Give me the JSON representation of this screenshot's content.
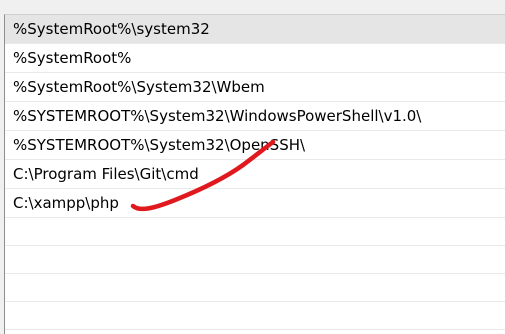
{
  "path_list": {
    "entries": [
      "%SystemRoot%\\system32",
      "%SystemRoot%",
      "%SystemRoot%\\System32\\Wbem",
      "%SYSTEMROOT%\\System32\\WindowsPowerShell\\v1.0\\",
      "%SYSTEMROOT%\\System32\\OpenSSH\\",
      "C:\\Program Files\\Git\\cmd",
      "C:\\xampp\\php"
    ],
    "selected_index": 0
  },
  "colors": {
    "annotation_stroke": "#e0191e",
    "selected_row": "#e5e5e5"
  }
}
